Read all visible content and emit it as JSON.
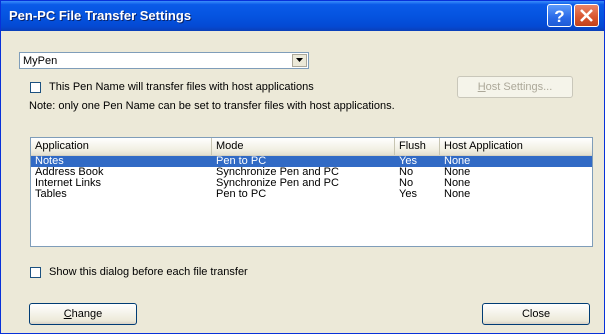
{
  "window": {
    "title": "Pen-PC File Transfer Settings",
    "title_icons": [
      "help-icon",
      "close-icon"
    ]
  },
  "pen_select": {
    "value": "MyPen",
    "icon": "chevron-down-icon"
  },
  "host_option": {
    "checkbox_label": "This Pen Name will transfer files with host applications",
    "checked": false,
    "host_settings_prefix": "",
    "host_settings_accel": "H",
    "host_settings_rest": "ost Settings..."
  },
  "note": "Note: only one Pen Name can be set to transfer files with host applications.",
  "table": {
    "columns": [
      "Application",
      "Mode",
      "Flush",
      "Host Application"
    ],
    "rows": [
      {
        "application": "Notes",
        "mode": "Pen to PC",
        "flush": "Yes",
        "host": "None",
        "selected": true
      },
      {
        "application": "Address Book",
        "mode": "Synchronize Pen and PC",
        "flush": "No",
        "host": "None",
        "selected": false
      },
      {
        "application": "Internet Links",
        "mode": "Synchronize Pen and PC",
        "flush": "No",
        "host": "None",
        "selected": false
      },
      {
        "application": "Tables",
        "mode": "Pen to PC",
        "flush": "Yes",
        "host": "None",
        "selected": false
      }
    ]
  },
  "show_dialog": {
    "label": "Show this dialog before each file transfer",
    "checked": false
  },
  "buttons": {
    "change_accel": "C",
    "change_rest": "hange",
    "close": "Close"
  },
  "colors": {
    "selection": "#316ac5",
    "titlebar": "#0554e0",
    "dialog_bg": "#ece9d8"
  }
}
